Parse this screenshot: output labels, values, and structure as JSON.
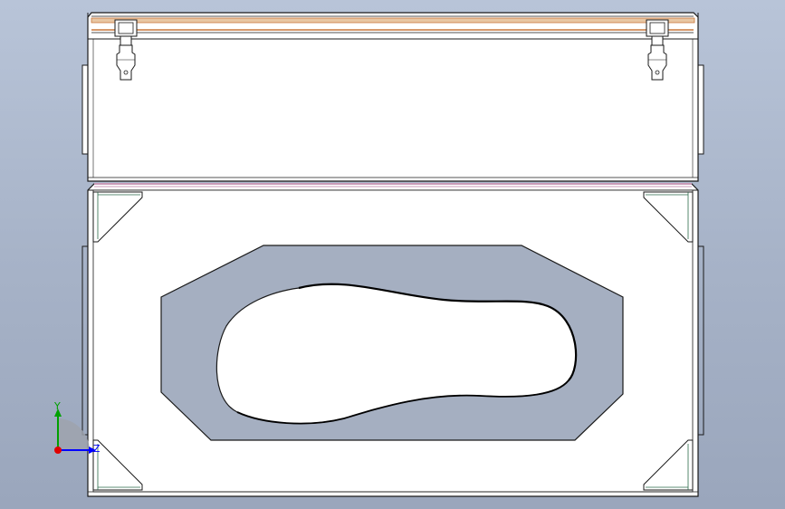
{
  "colors": {
    "background_top": "#b8c4d8",
    "background_bottom": "#9aa6bc",
    "panel_fill": "#ffffff",
    "edge": "#1a1a1a",
    "hinge_strip": "#c8763a",
    "seam_pink": "#c99ab8",
    "insert_fill": "#a5afc1",
    "axis_x": "#0000ff",
    "axis_y": "#00a000",
    "axis_origin": "#e00000"
  },
  "triad": {
    "y_label": "Y",
    "z_label": "Z"
  },
  "icons": {
    "latch_left": "latch-icon",
    "latch_right": "latch-icon",
    "triad": "coordinate-triad-icon"
  }
}
